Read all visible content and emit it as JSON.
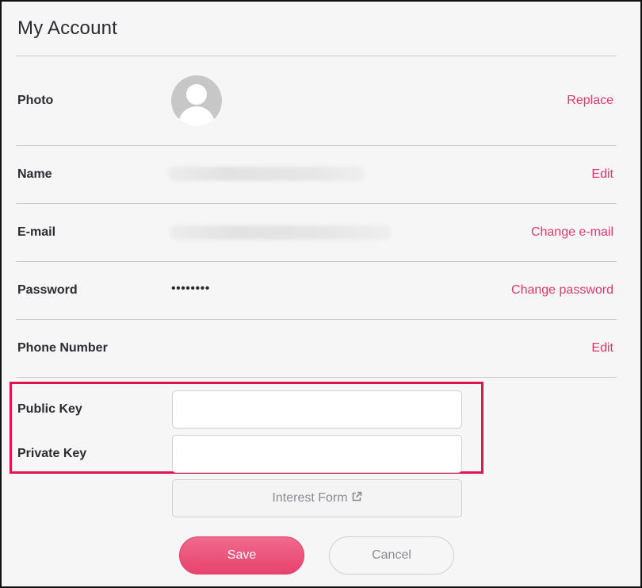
{
  "page": {
    "title": "My Account"
  },
  "photo": {
    "label": "Photo",
    "action": "Replace"
  },
  "name": {
    "label": "Name",
    "action": "Edit"
  },
  "email": {
    "label": "E-mail",
    "action": "Change e-mail"
  },
  "password": {
    "label": "Password",
    "value": "••••••••",
    "action": "Change password"
  },
  "phone": {
    "label": "Phone Number",
    "action": "Edit"
  },
  "keys": {
    "public_label": "Public Key",
    "public_value": "",
    "private_label": "Private Key",
    "private_value": ""
  },
  "interest_form": {
    "label": "Interest Form",
    "icon": "external-link-icon"
  },
  "buttons": {
    "save": "Save",
    "cancel": "Cancel"
  },
  "colors": {
    "accent": "#e03a6a",
    "highlight": "#e0144e",
    "save_bg": "#ec5a80"
  }
}
